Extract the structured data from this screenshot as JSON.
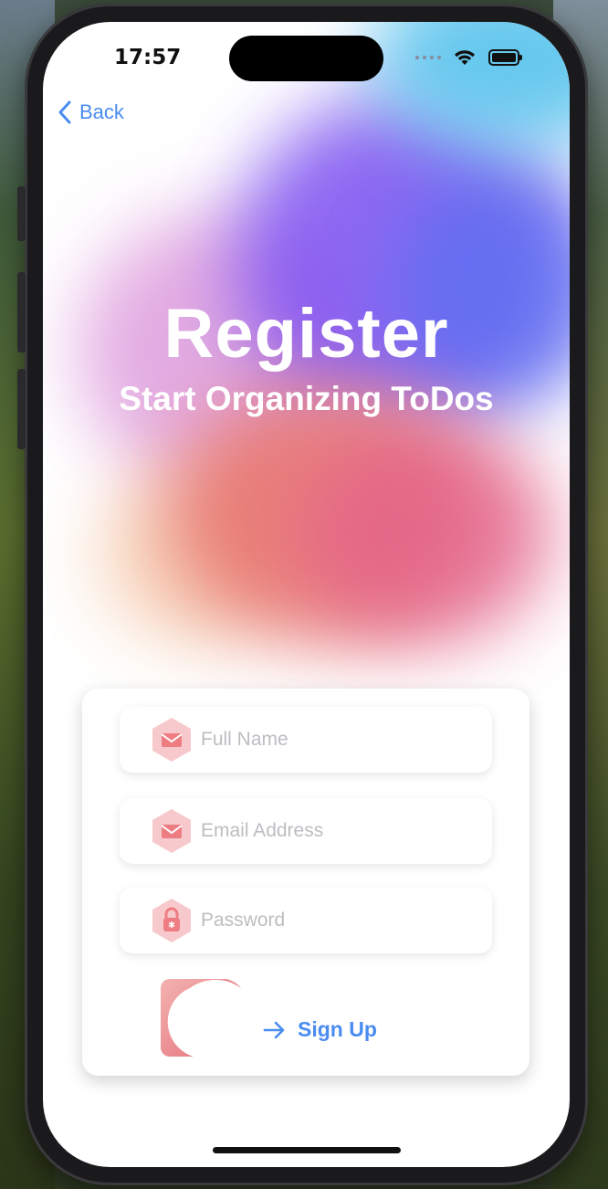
{
  "status_bar": {
    "time": "17:57"
  },
  "nav": {
    "back_label": "Back"
  },
  "header": {
    "title": "Register",
    "subtitle": "Start Organizing ToDos"
  },
  "form": {
    "full_name": {
      "placeholder": "Full Name",
      "icon": "envelope-icon"
    },
    "email": {
      "placeholder": "Email Address",
      "icon": "envelope-icon"
    },
    "password": {
      "placeholder": "Password",
      "icon": "lock-icon"
    },
    "signup_label": "Sign Up"
  },
  "colors": {
    "accent": "#4a8cf0",
    "icon_bg": "#f7c9cc",
    "icon_fg": "#ee7d83"
  }
}
